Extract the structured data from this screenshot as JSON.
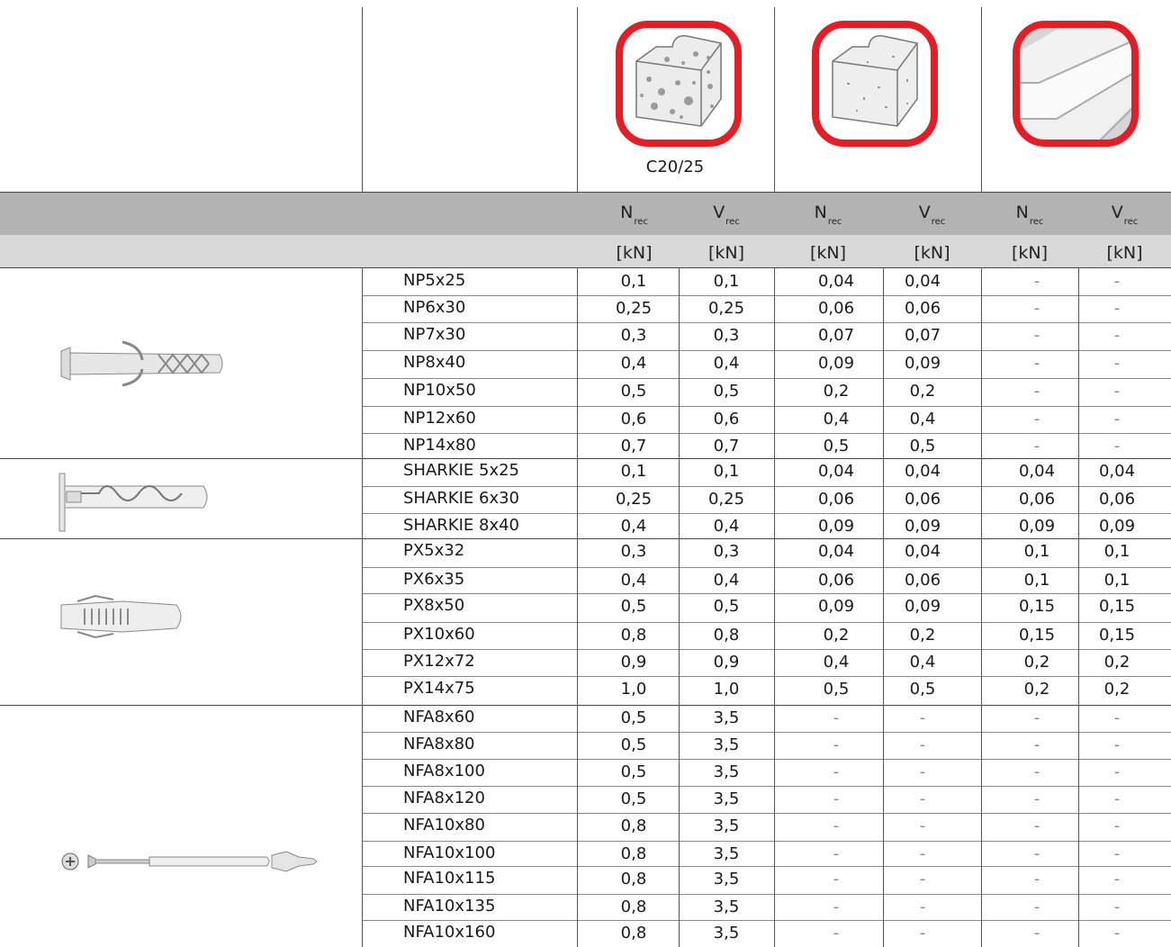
{
  "header": {
    "concrete_grade": "C20/25",
    "n_symbol": "N",
    "v_symbol": "V",
    "subscript": "rec",
    "unit": "[kN]"
  },
  "material_icons": [
    "solid-concrete-block-icon",
    "aerated-concrete-block-icon",
    "plasterboard-icon"
  ],
  "colors": {
    "icon_frame": "#e31e24",
    "header_band": "#b3b3b3",
    "unit_band": "#d9d9d9"
  },
  "groups": [
    {
      "icon": "nylon-plug-np-icon",
      "rows": [
        {
          "name": "NP5x25",
          "values": [
            "0,1",
            "0,1",
            "0,04",
            "0,04",
            "-",
            "-"
          ]
        },
        {
          "name": "NP6x30",
          "values": [
            "0,25",
            "0,25",
            "0,06",
            "0,06",
            "-",
            "-"
          ]
        },
        {
          "name": "NP7x30",
          "values": [
            "0,3",
            "0,3",
            "0,07",
            "0,07",
            "-",
            "-"
          ]
        },
        {
          "name": "NP8x40",
          "values": [
            "0,4",
            "0,4",
            "0,09",
            "0,09",
            "-",
            "-"
          ]
        },
        {
          "name": "NP10x50",
          "values": [
            "0,5",
            "0,5",
            "0,2",
            "0,2",
            "-",
            "-"
          ]
        },
        {
          "name": "NP12x60",
          "values": [
            "0,6",
            "0,6",
            "0,4",
            "0,4",
            "-",
            "-"
          ]
        },
        {
          "name": "NP14x80",
          "values": [
            "0,7",
            "0,7",
            "0,5",
            "0,5",
            "-",
            "-"
          ]
        }
      ]
    },
    {
      "icon": "sharkie-plug-icon",
      "rows": [
        {
          "name": "SHARKIE 5x25",
          "values": [
            "0,1",
            "0,1",
            "0,04",
            "0,04",
            "0,04",
            "0,04"
          ]
        },
        {
          "name": "SHARKIE 6x30",
          "values": [
            "0,25",
            "0,25",
            "0,06",
            "0,06",
            "0,06",
            "0,06"
          ]
        },
        {
          "name": "SHARKIE 8x40",
          "values": [
            "0,4",
            "0,4",
            "0,09",
            "0,09",
            "0,09",
            "0,09"
          ]
        }
      ]
    },
    {
      "icon": "px-plug-icon",
      "rows": [
        {
          "name": "PX5x32",
          "values": [
            "0,3",
            "0,3",
            "0,04",
            "0,04",
            "0,1",
            "0,1"
          ]
        },
        {
          "name": "PX6x35",
          "values": [
            "0,4",
            "0,4",
            "0,06",
            "0,06",
            "0,1",
            "0,1"
          ]
        },
        {
          "name": "PX8x50",
          "values": [
            "0,5",
            "0,5",
            "0,09",
            "0,09",
            "0,15",
            "0,15"
          ]
        },
        {
          "name": "PX10x60",
          "values": [
            "0,8",
            "0,8",
            "0,2",
            "0,2",
            "0,15",
            "0,15"
          ]
        },
        {
          "name": "PX12x72",
          "values": [
            "0,9",
            "0,9",
            "0,4",
            "0,4",
            "0,2",
            "0,2"
          ]
        },
        {
          "name": "PX14x75",
          "values": [
            "1,0",
            "1,0",
            "0,5",
            "0,5",
            "0,2",
            "0,2"
          ]
        }
      ]
    },
    {
      "icon": "frame-fixing-nfa-icon",
      "rows": [
        {
          "name": "NFA8x60",
          "values": [
            "0,5",
            "3,5",
            "-",
            "-",
            "-",
            "-"
          ]
        },
        {
          "name": "NFA8x80",
          "values": [
            "0,5",
            "3,5",
            "-",
            "-",
            "-",
            "-"
          ]
        },
        {
          "name": "NFA8x100",
          "values": [
            "0,5",
            "3,5",
            "-",
            "-",
            "-",
            "-"
          ]
        },
        {
          "name": "NFA8x120",
          "values": [
            "0,5",
            "3,5",
            "-",
            "-",
            "-",
            "-"
          ]
        },
        {
          "name": "NFA10x80",
          "values": [
            "0,8",
            "3,5",
            "-",
            "-",
            "-",
            "-"
          ]
        },
        {
          "name": "NFA10x100",
          "values": [
            "0,8",
            "3,5",
            "-",
            "-",
            "-",
            "-"
          ]
        },
        {
          "name": "NFA10x115",
          "values": [
            "0,8",
            "3,5",
            "-",
            "-",
            "-",
            "-"
          ]
        },
        {
          "name": "NFA10x135",
          "values": [
            "0,8",
            "3,5",
            "-",
            "-",
            "-",
            "-"
          ]
        },
        {
          "name": "NFA10x160",
          "values": [
            "0,8",
            "3,5",
            "-",
            "-",
            "-",
            "-"
          ]
        }
      ]
    }
  ]
}
